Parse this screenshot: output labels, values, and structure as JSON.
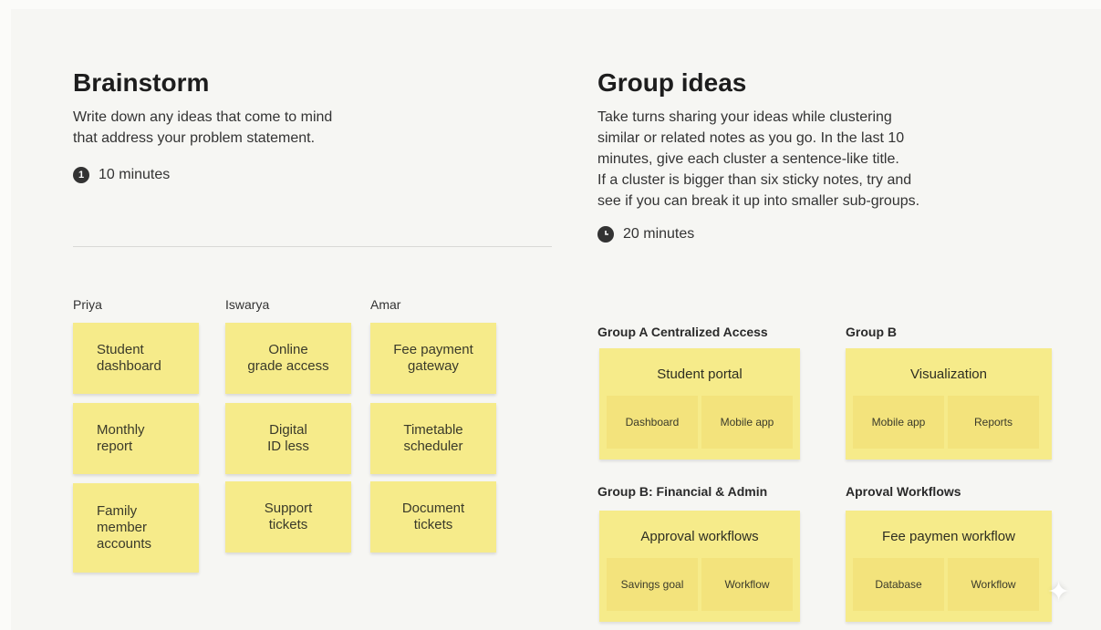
{
  "brainstorm": {
    "title": "Brainstorm",
    "description": "Write down any ideas that come to mind\nthat address your problem statement.",
    "timer_icon": "1",
    "timer": "10 minutes",
    "people": [
      {
        "name": "Priya",
        "notes": [
          "Student\ndashboard",
          "Monthly\nreport",
          "Family\nmember\naccounts"
        ]
      },
      {
        "name": "Iswarya",
        "notes": [
          "Online\ngrade access",
          "Digital\nID less",
          "Support\ntickets"
        ]
      },
      {
        "name": "Amar",
        "notes": [
          "Fee payment\ngateway",
          "Timetable\nscheduler",
          "Document\ntickets"
        ]
      }
    ]
  },
  "group_ideas": {
    "title": "Group ideas",
    "description": "Take turns sharing your ideas while clustering\nsimilar or related notes as you go. In the last 10\nminutes, give each cluster a sentence-like title.\nIf a cluster is bigger than six sticky notes, try and\nsee if you can break it up into smaller sub-groups.",
    "timer_icon": "clock-icon",
    "timer": "20 minutes",
    "groups": [
      {
        "label": "Group A Centralized Access",
        "title": "Student portal",
        "subs": [
          "Dashboard",
          "Mobile app"
        ]
      },
      {
        "label": "Group B",
        "title": "Visualization",
        "subs": [
          "Mobile app",
          "Reports"
        ]
      },
      {
        "label": "Group B: Financial & Admin",
        "title": "Approval workflows",
        "subs": [
          "Savings goal",
          "Workflow"
        ]
      },
      {
        "label": "Aproval Workflows",
        "title": "Fee paymen workflow",
        "subs": [
          "Database",
          "Workflow"
        ]
      }
    ]
  },
  "colors": {
    "sticky": "#f6eb8a",
    "background": "#f6f6f3"
  }
}
